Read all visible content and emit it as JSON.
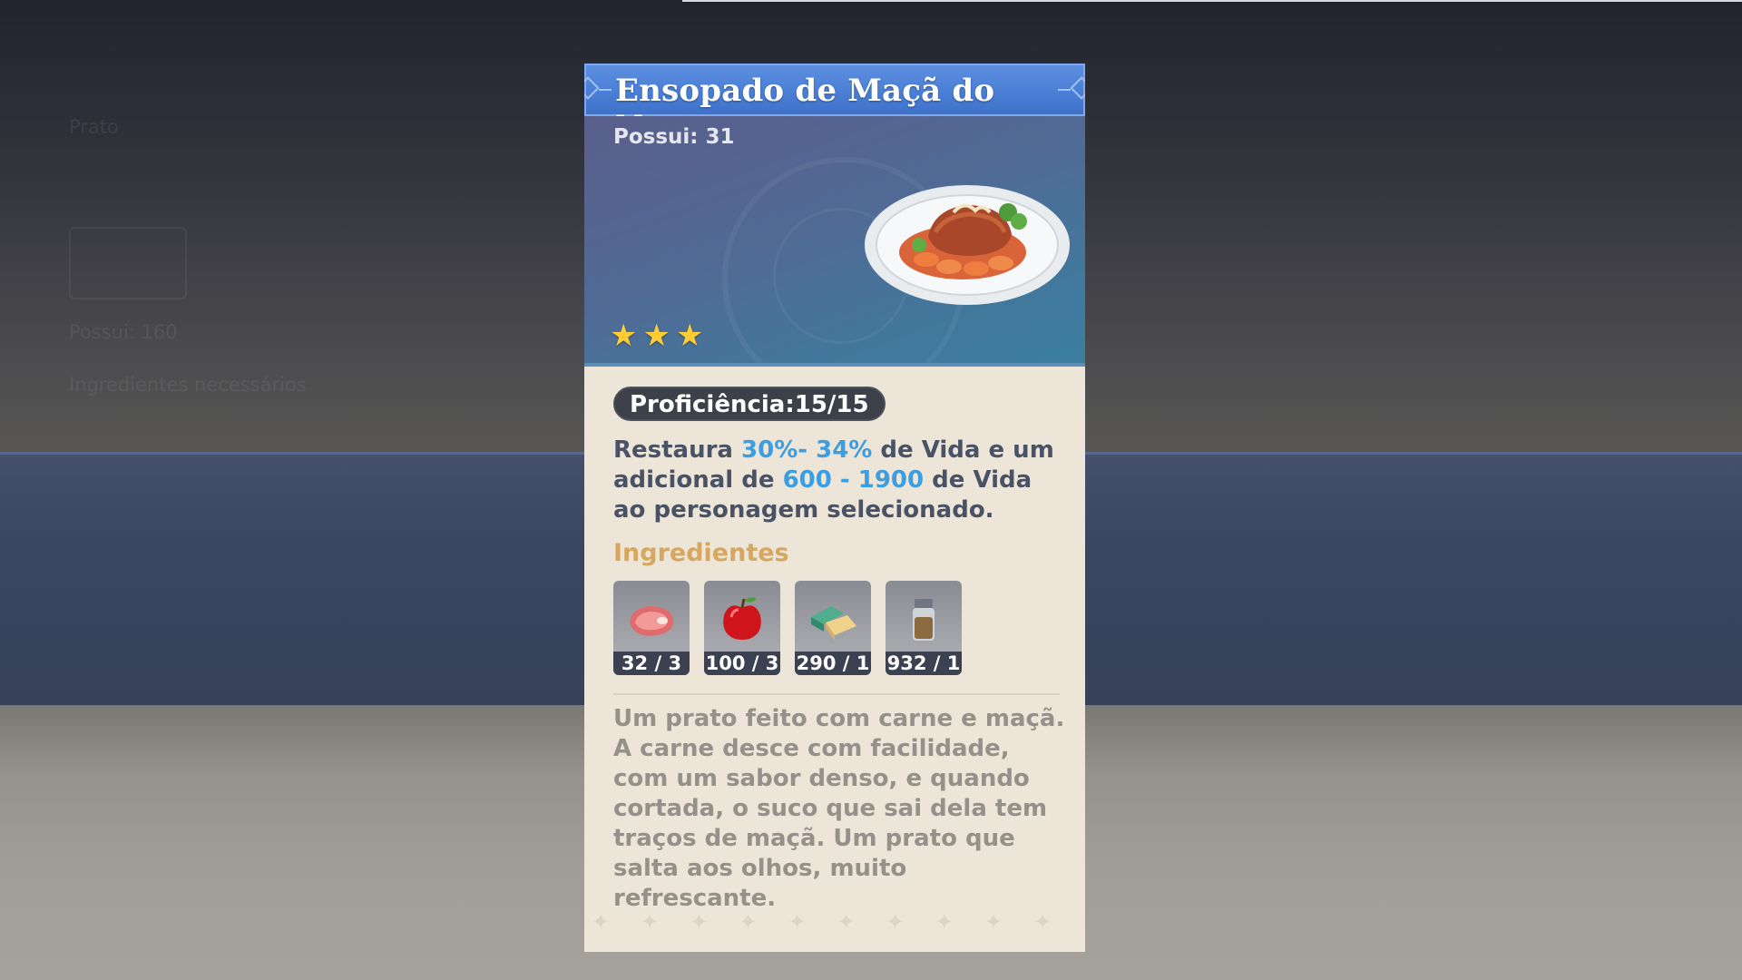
{
  "background": {
    "ghost_lines": [
      "Prato",
      "Possui: 160",
      "Ingredientes necessários"
    ]
  },
  "card": {
    "title": "Ensopado de Maçã do Norte",
    "owned": "Possui: 31",
    "rarity_stars": 3,
    "star_glyph": "★",
    "proficiency": "Proficiência:15/15",
    "description": {
      "p1": "Restaura ",
      "hl1": "30%- 34%",
      "p2": " de Vida e um adicional de ",
      "hl2": "600 - 1900",
      "p3": " de Vida ao personagem selecionado."
    },
    "ingredients_title": "Ingredientes",
    "ingredients": [
      {
        "icon": "raw-meat-icon",
        "count": "32 / 3"
      },
      {
        "icon": "apple-icon",
        "count": "100 / 3"
      },
      {
        "icon": "butter-icon",
        "count": "290 / 1"
      },
      {
        "icon": "pepper-jar-icon",
        "count": "932 / 1"
      }
    ],
    "lore": "Um prato feito com carne e maçã. A carne desce com facilidade, com um sabor denso, e quando cortada, o suco que sai dela tem traços de maçã. Um prato que salta aos olhos, muito refrescante."
  },
  "colors": {
    "header_blue": "#4a7fd6",
    "highlight_blue": "#3a9ee0",
    "ingredient_title_gold": "#d6a75f",
    "star_gold": "#ffcc33",
    "body_parchment": "#ece5d8"
  }
}
